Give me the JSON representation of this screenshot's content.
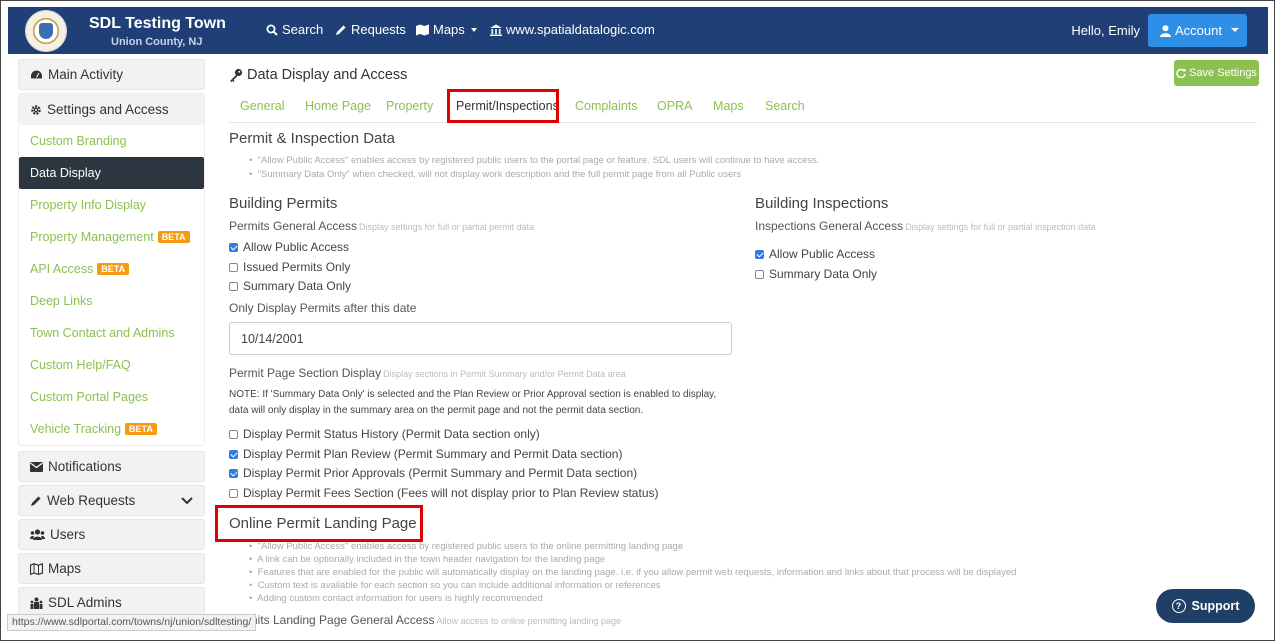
{
  "header": {
    "town_name": "SDL Testing Town",
    "county": "Union County, NJ",
    "nav": [
      {
        "label": "Search",
        "icon": "search-icon"
      },
      {
        "label": "Requests",
        "icon": "pencil-icon"
      },
      {
        "label": "Maps",
        "icon": "map-icon"
      },
      {
        "label": "www.spatialdatalogic.com",
        "icon": "building-icon"
      }
    ],
    "greeting": "Hello, Emily",
    "account_label": "Account"
  },
  "sidebar": {
    "main_activity": "Main Activity",
    "settings_access": "Settings and Access",
    "sub_items": [
      {
        "label": "Custom Branding",
        "beta": ""
      },
      {
        "label": "Data Display",
        "beta": ""
      },
      {
        "label": "Property Info Display",
        "beta": ""
      },
      {
        "label": "Property Management",
        "beta": "BETA"
      },
      {
        "label": "API Access",
        "beta": "BETA"
      },
      {
        "label": "Deep Links",
        "beta": ""
      },
      {
        "label": "Town Contact and Admins",
        "beta": ""
      },
      {
        "label": "Custom Help/FAQ",
        "beta": ""
      },
      {
        "label": "Custom Portal Pages",
        "beta": ""
      },
      {
        "label": "Vehicle Tracking",
        "beta": "BETA"
      }
    ],
    "notifications": "Notifications",
    "web_requests": "Web Requests",
    "users": "Users",
    "maps": "Maps",
    "sdl_admins": "SDL Admins"
  },
  "main": {
    "title": "Data Display and Access",
    "save_label": "Save Settings",
    "tabs": [
      "General",
      "Home Page",
      "Property",
      "Permit/Inspections",
      "Complaints",
      "OPRA",
      "Maps",
      "Search"
    ],
    "section_title": "Permit & Inspection Data",
    "section_notes": [
      "\"Allow Public Access\" enables access by registered public users to the portal page or feature. SDL users will continue to have access.",
      "\"Summary Data Only\" when checked, will not display work description and the full permit page from all Public users"
    ],
    "building_permits": {
      "title": "Building Permits",
      "general_label": "Permits General Access",
      "general_hint": "Display settings for full or partial permit data",
      "options": [
        {
          "label": "Allow Public Access",
          "checked": true
        },
        {
          "label": "Issued Permits Only",
          "checked": false
        },
        {
          "label": "Summary Data Only",
          "checked": false
        }
      ],
      "date_label": "Only Display Permits after this date",
      "date_value": "10/14/2001",
      "section_display_label": "Permit Page Section Display",
      "section_display_hint": "Display sections in Permit Summary and/or Permit Data area",
      "note": "NOTE: If 'Summary Data Only' is selected and the Plan Review or Prior Approval section is enabled to display, data will only display in the summary area on the permit page and not the permit data section.",
      "sections": [
        {
          "label": "Display Permit Status History (Permit Data section only)",
          "checked": false
        },
        {
          "label": "Display Permit Plan Review (Permit Summary and Permit Data section)",
          "checked": true
        },
        {
          "label": "Display Permit Prior Approvals (Permit Summary and Permit Data section)",
          "checked": true
        },
        {
          "label": "Display Permit Fees Section (Fees will not display prior to Plan Review status)",
          "checked": false
        }
      ]
    },
    "building_inspections": {
      "title": "Building Inspections",
      "general_label": "Inspections General Access",
      "general_hint": "Display settings for full or partial inspection data",
      "options": [
        {
          "label": "Allow Public Access",
          "checked": true
        },
        {
          "label": "Summary Data Only",
          "checked": false
        }
      ]
    },
    "landing": {
      "title": "Online Permit Landing Page",
      "notes": [
        "\"Allow Public Access\" enables access by registered public users to the online permitting landing page",
        "A link can be optionally included in the town header navigation for the landing page",
        "Features that are enabled for the public will automatically display on the landing page. i.e. if you allow permit web requests, information and links about that process will be displayed",
        "Custom text is available for each section so you can include additional information or references",
        "Adding custom contact information for users is highly recommended"
      ],
      "general_label": "Permits Landing Page General Access",
      "general_hint": "Allow access to online permitting landing page"
    }
  },
  "status_url": "https://www.sdlportal.com/towns/nj/union/sdltesting/",
  "support_label": "Support",
  "colors": {
    "navbar": "#1f3f76",
    "accent_green": "#8cc152",
    "account_blue": "#2f8fe6",
    "highlight_red": "#e00000"
  }
}
